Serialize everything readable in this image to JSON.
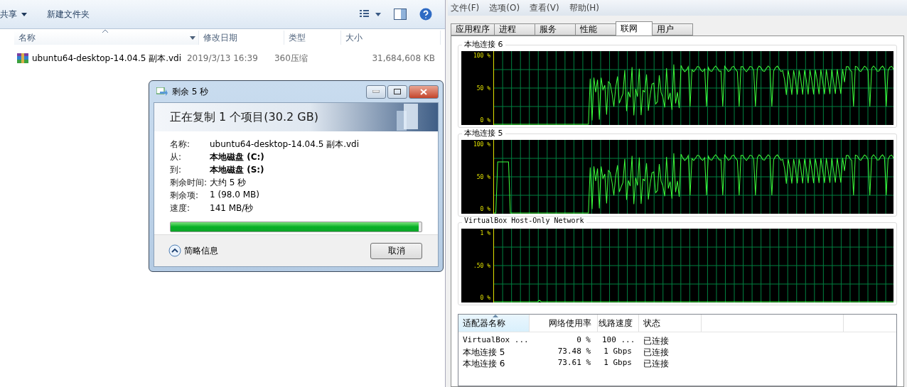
{
  "explorer": {
    "toolbar": [
      {
        "label": "共享",
        "dropdown": true
      },
      {
        "label": "新建文件夹",
        "dropdown": false
      }
    ],
    "columns": [
      {
        "label": "名称",
        "sorted": true
      },
      {
        "label": "修改日期",
        "sorted": false
      },
      {
        "label": "类型",
        "sorted": false
      },
      {
        "label": "大小",
        "sorted": false
      }
    ],
    "files": [
      {
        "name": "ubuntu64-desktop-14.04.5 副本.vdi",
        "modified": "2019/3/13 16:39",
        "type": "360压缩",
        "size": "31,684,608 KB"
      }
    ]
  },
  "copy_dialog": {
    "title": "剩余 5 秒",
    "heading": "正在复制 1 个项目(30.2 GB)",
    "details": [
      {
        "label": "名称:",
        "value": "ubuntu64-desktop-14.04.5 副本.vdi",
        "bold": false
      },
      {
        "label": "从:",
        "value": "本地磁盘 (C:)",
        "bold": true
      },
      {
        "label": "到:",
        "value": "本地磁盘 (S:)",
        "bold": true
      },
      {
        "label": "剩余时间:",
        "value": "大约 5 秒",
        "bold": false
      },
      {
        "label": "剩余项:",
        "value": "1 (98.0 MB)",
        "bold": false
      },
      {
        "label": "速度:",
        "value": "141 MB/秒",
        "bold": false
      }
    ],
    "level": 0.99,
    "details_toggle": "简略信息",
    "cancel": "取消"
  },
  "task_manager": {
    "menu": [
      "文件(F)",
      "选项(O)",
      "查看(V)",
      "帮助(H)"
    ],
    "tabs": [
      {
        "label": "应用程序",
        "selected": false
      },
      {
        "label": "进程",
        "selected": false
      },
      {
        "label": "服务",
        "selected": false
      },
      {
        "label": "性能",
        "selected": false
      },
      {
        "label": "联网",
        "selected": true
      },
      {
        "label": "用户",
        "selected": false
      }
    ],
    "graphs": [
      {
        "title": "本地连接 6",
        "kind": "busy",
        "ticks": [
          "100 %",
          "50 %",
          "0 %"
        ]
      },
      {
        "title": "本地连接 5",
        "kind": "busy",
        "ticks": [
          "100 %",
          "50 %",
          "0 %"
        ]
      },
      {
        "title": "VirtualBox Host-Only Network",
        "kind": "idle",
        "ticks": [
          "1 %",
          ".50 %",
          "0 %"
        ]
      }
    ],
    "adapters": {
      "columns": [
        {
          "label": "适配器名称",
          "sorted": true
        },
        {
          "label": "网络使用率",
          "sorted": false
        },
        {
          "label": "线路速度",
          "sorted": false
        },
        {
          "label": "状态",
          "sorted": false
        }
      ],
      "rows": [
        [
          "VirtualBox ...",
          "0 %",
          "100 ...",
          "已连接"
        ],
        [
          "本地连接 5",
          "73.48 %",
          "1 Gbps",
          "已连接"
        ],
        [
          "本地连接 6",
          "73.61 %",
          "1 Gbps",
          "已连接"
        ]
      ]
    }
  }
}
